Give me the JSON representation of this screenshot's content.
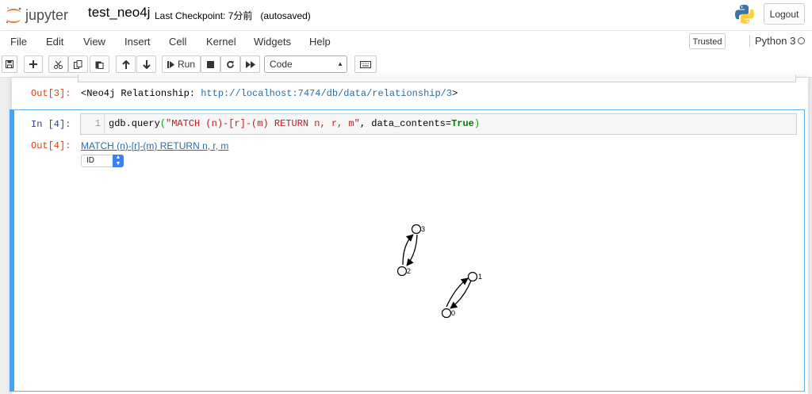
{
  "header": {
    "logo_text": "jupyter",
    "notebook_name": "test_neo4j",
    "checkpoint": "Last Checkpoint: 7分前",
    "autosaved": "(autosaved)",
    "logout_label": "Logout"
  },
  "menu": {
    "items": [
      "File",
      "Edit",
      "View",
      "Insert",
      "Cell",
      "Kernel",
      "Widgets",
      "Help"
    ],
    "trusted_label": "Trusted",
    "kernel_name": "Python 3"
  },
  "toolbar": {
    "run_label": "Run",
    "cell_type": "Code"
  },
  "cells": {
    "out3_prompt": "Out[3]:",
    "out3_prefix": "<Neo4j Relationship: ",
    "out3_link": "http://localhost:7474/db/data/relationship/3",
    "out3_suffix": ">",
    "in4_prompt": "In [4]:",
    "line_number": "1",
    "code_prefix": "gdb.query",
    "code_open": "(",
    "code_string": "\"MATCH (n)-[r]-(m) RETURN n, r, m\"",
    "code_mid": ", data_contents=",
    "code_kw": "True",
    "code_close": ")",
    "out4_prompt": "Out[4]:",
    "out4_link": "MATCH (n)-[r]-(m) RETURN n, r, m",
    "id_select": "ID"
  },
  "graph": {
    "nodes": [
      {
        "label": "3"
      },
      {
        "label": "2"
      },
      {
        "label": "1"
      },
      {
        "label": "0"
      }
    ]
  }
}
